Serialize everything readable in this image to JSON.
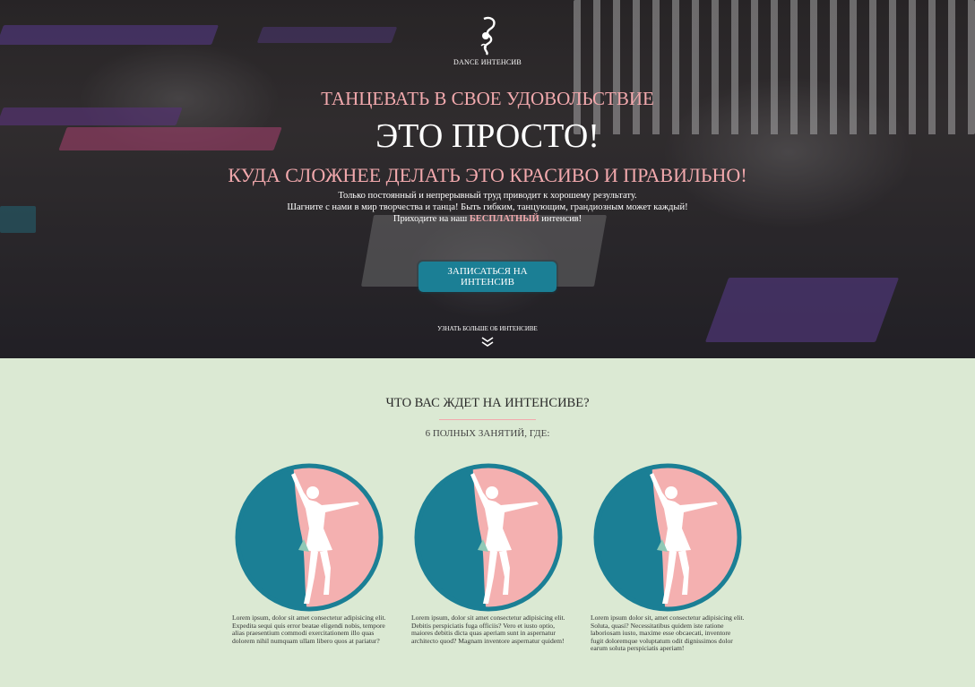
{
  "hero": {
    "logo_text": "DANCE ИНТЕНСИВ",
    "headline_1": "ТАНЦЕВАТЬ В СВОЕ УДОВОЛЬСТВИЕ",
    "headline_2": "ЭТО ПРОСТО!",
    "headline_3": "КУДА СЛОЖНЕЕ ДЕЛАТЬ ЭТО КРАСИВО И ПРАВИЛЬНО!",
    "desc_line_1": "Только постоянный и непрерывный труд приводит к хорошему результату.",
    "desc_line_2": "Шагните с нами в мир творчества и танца! Быть гибким, танцующим, грандиозным может каждый!",
    "desc_line_3_pre": "Приходите на наш ",
    "desc_line_3_free": "БЕСПЛАТНЫЙ",
    "desc_line_3_post": " интенсив!",
    "cta_label": "ЗАПИСАТЬСЯ НА ИНТЕНСИВ",
    "more_label": "УЗНАТЬ БОЛЬШЕ ОБ ИНТЕНСИВЕ"
  },
  "features": {
    "title": "ЧТО ВАС ЖДЕТ НА ИНТЕНСИВЕ?",
    "subtitle": "6 ПОЛНЫХ ЗАНЯТИЙ, ГДЕ:",
    "cards": [
      {
        "text": "Lorem ipsum, dolor sit amet consectetur adipisicing elit. Expedita sequi quis error beatae eligendi nobis, tempore alias praesentium commodi exercitationem illo quas dolorem nihil numquam ullam libero quos at pariatur?"
      },
      {
        "text": "Lorem ipsum, dolor sit amet consectetur adipisicing elit. Debitis perspiciatis fuga officiis? Vero et iusto optio, maiores debitis dicta quas aperiam sunt in aspernatur architecto quod? Magnam inventore aspernatur quidem!"
      },
      {
        "text": "Lorem ipsum dolor sit, amet consectetur adipisicing elit. Soluta, quasi? Necessitatibus quidem iste ratione laboriosam iusto, maxime esse obcaecati, inventore fugit doloremque voluptatum odit dignissimos dolor earum soluta perspiciatis aperiam!"
      }
    ]
  },
  "colors": {
    "accent_pink": "#f2a9ad",
    "accent_teal": "#1b7f95",
    "section_bg": "#dbe9d3"
  },
  "icons": {
    "logo": "dancer-head-logo-icon",
    "scroll": "double-chevron-down-icon",
    "card": "ballerina-circle-icon"
  }
}
